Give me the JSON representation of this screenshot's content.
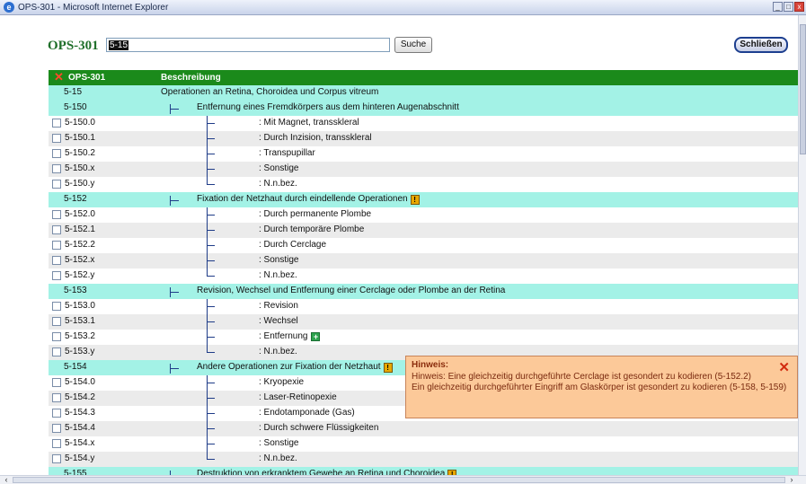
{
  "window": {
    "icon": "ie-icon",
    "title": "OPS-301 - Microsoft Internet Explorer",
    "minimize": "_",
    "maximize": "□",
    "close": "x"
  },
  "header": {
    "title": "OPS-301",
    "search_value": "5-15",
    "search_button": "Suche",
    "close_button": "Schließen"
  },
  "table": {
    "columns": {
      "code": "OPS-301",
      "description": "Beschreibung"
    },
    "rows": [
      {
        "code": "5-15",
        "desc": "Operationen an Retina, Choroidea und Corpus vitreum"
      },
      {
        "code": "5-150",
        "desc": "Entfernung eines Fremdkörpers aus dem hinteren Augenabschnitt"
      },
      {
        "code": "5-150.0",
        "desc": ": Mit Magnet, transskleral"
      },
      {
        "code": "5-150.1",
        "desc": ": Durch Inzision, transskleral"
      },
      {
        "code": "5-150.2",
        "desc": ": Transpupillar"
      },
      {
        "code": "5-150.x",
        "desc": ": Sonstige"
      },
      {
        "code": "5-150.y",
        "desc": ": N.n.bez."
      },
      {
        "code": "5-152",
        "desc": "Fixation der Netzhaut durch eindellende Operationen"
      },
      {
        "code": "5-152.0",
        "desc": ": Durch permanente Plombe"
      },
      {
        "code": "5-152.1",
        "desc": ": Durch temporäre Plombe"
      },
      {
        "code": "5-152.2",
        "desc": ": Durch Cerclage"
      },
      {
        "code": "5-152.x",
        "desc": ": Sonstige"
      },
      {
        "code": "5-152.y",
        "desc": ": N.n.bez."
      },
      {
        "code": "5-153",
        "desc": "Revision, Wechsel und Entfernung einer Cerclage oder Plombe an der Retina"
      },
      {
        "code": "5-153.0",
        "desc": ": Revision"
      },
      {
        "code": "5-153.1",
        "desc": ": Wechsel"
      },
      {
        "code": "5-153.2",
        "desc": ": Entfernung"
      },
      {
        "code": "5-153.y",
        "desc": ": N.n.bez."
      },
      {
        "code": "5-154",
        "desc": "Andere Operationen zur Fixation der Netzhaut"
      },
      {
        "code": "5-154.0",
        "desc": ": Kryopexie"
      },
      {
        "code": "5-154.2",
        "desc": ": Laser-Retinopexie"
      },
      {
        "code": "5-154.3",
        "desc": ": Endotamponade (Gas)"
      },
      {
        "code": "5-154.4",
        "desc": ": Durch schwere Flüssigkeiten"
      },
      {
        "code": "5-154.x",
        "desc": ": Sonstige"
      },
      {
        "code": "5-154.y",
        "desc": ": N.n.bez."
      },
      {
        "code": "5-155",
        "desc": "Destruktion von erkranktem Gewebe an Retina und Choroidea"
      }
    ]
  },
  "icons": {
    "warning": "!",
    "add": "+",
    "remove": "✕"
  },
  "hint": {
    "title": "Hinweis:",
    "line1": "Hinweis: Eine gleichzeitig durchgeführte Cerclage ist gesondert zu kodieren (5-152.2)",
    "line2": "Ein gleichzeitig durchgeführter Eingriff am Glaskörper ist gesondert zu kodieren (5-158, 5-159)",
    "close": "✕"
  },
  "colors": {
    "header_green": "#1b8a1b",
    "parent_row": "#a3f2e6",
    "alt_row": "#ebebeb",
    "title_green": "#1f6f2a",
    "hint_bg": "#fcc999"
  }
}
